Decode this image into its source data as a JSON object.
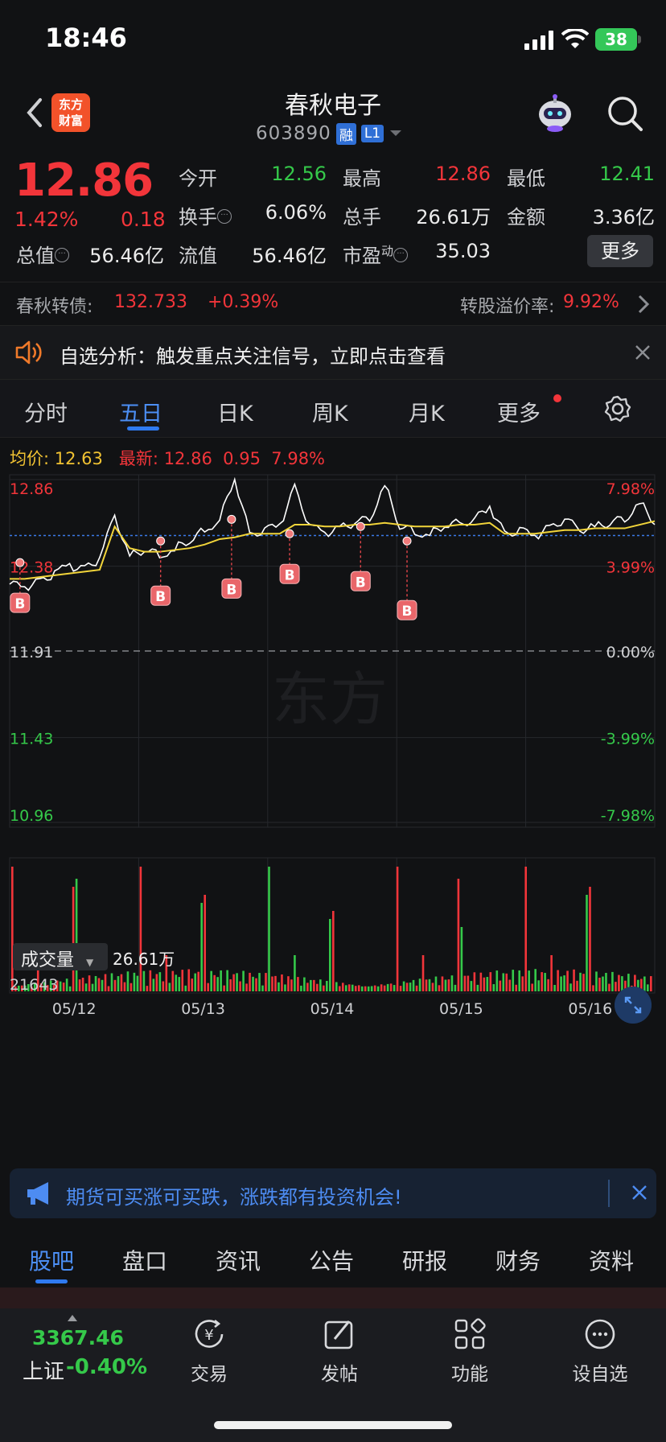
{
  "status_bar": {
    "time": "18:46",
    "battery": "38"
  },
  "header": {
    "brand_line1": "东方",
    "brand_line2": "财富",
    "stock_name": "春秋电子",
    "stock_code": "603890",
    "tag_margin": "融",
    "tag_level": "L1"
  },
  "quote": {
    "price": "12.86",
    "change_pct": "1.42%",
    "change": "0.18",
    "open_label": "今开",
    "open": "12.56",
    "high_label": "最高",
    "high": "12.86",
    "low_label": "最低",
    "low": "12.41",
    "turnover_label": "换手",
    "turnover": "6.06%",
    "volume_label": "总手",
    "volume": "26.61万",
    "amount_label": "金额",
    "amount": "3.36亿",
    "mktcap_label": "总值",
    "mktcap": "56.46亿",
    "float_label": "流值",
    "float_cap": "56.46亿",
    "pe_label": "市盈",
    "pe_sup": "动",
    "pe": "35.03",
    "more_label": "更多"
  },
  "bond": {
    "label": "春秋转债:",
    "price": "132.733",
    "change": "+0.39%",
    "premium_label": "转股溢价率:",
    "premium": "9.92%"
  },
  "alert": {
    "text": "自选分析：触发重点关注信号，立即点击查看"
  },
  "period_tabs": [
    "分时",
    "五日",
    "日K",
    "周K",
    "月K",
    "更多"
  ],
  "active_period_tab": "五日",
  "chart_legend": {
    "avg_label": "均价:",
    "avg_value": "12.63",
    "latest_label": "最新:",
    "latest_value": "12.86",
    "latest_change": "0.95",
    "latest_pct": "7.98%"
  },
  "chart_data": {
    "type": "line",
    "title": "",
    "price_axis_left": [
      "12.86",
      "12.38",
      "11.91",
      "11.43",
      "10.96"
    ],
    "price_axis_right": [
      "7.98%",
      "3.99%",
      "0.00%",
      "-3.99%",
      "-7.98%"
    ],
    "ylim": [
      10.96,
      12.86
    ],
    "prev_close": 11.91,
    "reference_line": 12.55,
    "x_dates": [
      "05/12",
      "05/13",
      "05/14",
      "05/15",
      "05/16"
    ],
    "buy_marker_label": "B",
    "buy_signals": [
      {
        "day": "05/12",
        "price": 12.4
      },
      {
        "day": "05/13",
        "price": 12.52
      },
      {
        "day": "05/13",
        "price": 12.64
      },
      {
        "day": "05/14",
        "price": 12.56
      },
      {
        "day": "05/14",
        "price": 12.6
      },
      {
        "day": "05/15",
        "price": 12.52
      }
    ],
    "series": [
      {
        "name": "最新",
        "color": "#ffffff",
        "values": [
          12.28,
          12.26,
          12.3,
          12.34,
          12.38,
          12.37,
          12.42,
          12.66,
          12.44,
          12.47,
          12.44,
          12.48,
          12.52,
          12.58,
          12.64,
          12.86,
          12.56,
          12.58,
          12.6,
          12.82,
          12.6,
          12.56,
          12.6,
          12.62,
          12.64,
          12.84,
          12.6,
          12.57,
          12.56,
          12.6,
          12.62,
          12.64,
          12.7,
          12.56,
          12.58,
          12.54,
          12.6,
          12.64,
          12.58,
          12.61,
          12.62,
          12.64,
          12.74,
          12.62
        ]
      },
      {
        "name": "均价",
        "color": "#f1d43a",
        "values": [
          12.31,
          12.31,
          12.32,
          12.33,
          12.34,
          12.35,
          12.36,
          12.6,
          12.48,
          12.46,
          12.46,
          12.47,
          12.48,
          12.5,
          12.53,
          12.54,
          12.56,
          12.56,
          12.56,
          12.61,
          12.61,
          12.6,
          12.6,
          12.61,
          12.61,
          12.62,
          12.61,
          12.6,
          12.6,
          12.6,
          12.61,
          12.61,
          12.62,
          12.56,
          12.56,
          12.56,
          12.57,
          12.58,
          12.58,
          12.59,
          12.59,
          12.59,
          12.61,
          12.63
        ]
      }
    ],
    "volume_label": "成交量",
    "volume_total": "26.61万",
    "volume_max": "21643"
  },
  "promo": {
    "text": "期货可买涨可买跌，涨跌都有投资机会!"
  },
  "section_tabs": [
    "股吧",
    "盘口",
    "资讯",
    "公告",
    "研报",
    "财务",
    "资料"
  ],
  "active_section_tab": "股吧",
  "bottom_nav": {
    "index_value": "3367.46",
    "index_name": "上证",
    "index_pct": "-0.40%",
    "items": [
      "交易",
      "发帖",
      "功能",
      "设自选"
    ]
  },
  "colors": {
    "up": "#f2353a",
    "down": "#35c94a",
    "accent": "#4c8ff5",
    "avg_line": "#f1d43a"
  }
}
